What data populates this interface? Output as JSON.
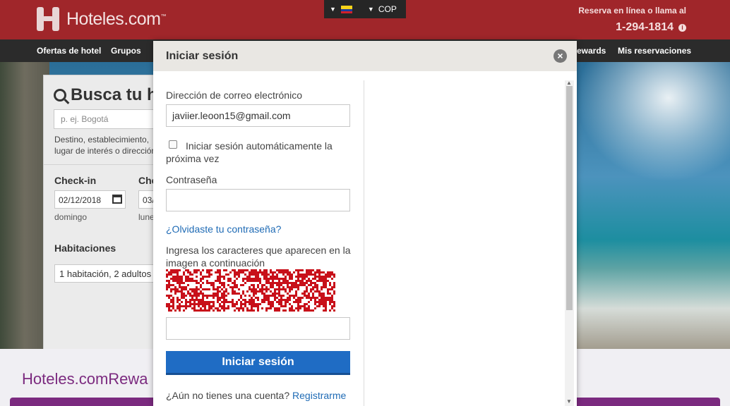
{
  "header": {
    "brand": "Hoteles.com",
    "brand_tm": "™",
    "currency": "COP",
    "phone_label": "Reserva en línea o llama al",
    "phone_number": "1-294-1814",
    "info_glyph": "i"
  },
  "nav": {
    "items": [
      "Ofertas de hotel",
      "Grupos",
      "ewards",
      "Mis reservaciones"
    ]
  },
  "search": {
    "title": "Busca tu h",
    "destination_placeholder": "p. ej. Bogotá",
    "destination_hint": "Destino, establecimiento, lugar de interés o dirección",
    "checkin_label": "Check-in",
    "checkout_label": "Che",
    "checkin_value": "02/12/2018",
    "checkout_value": "03/",
    "checkin_day": "domingo",
    "checkout_day": "lune",
    "rooms_label": "Habitaciones",
    "rooms_value": "1 habitación, 2 adultos"
  },
  "rewards": {
    "logo_text": "Hoteles.comRewa"
  },
  "modal": {
    "title": "Iniciar sesión",
    "close_glyph": "×",
    "email_label": "Dirección de correo electrónico",
    "email_value": "javiier.leoon15@gmail.com",
    "remember_label": "Iniciar sesión automáticamente la próxima vez",
    "password_label": "Contraseña",
    "password_value": "",
    "forgot_link": "¿Olvidaste tu contraseña?",
    "captcha_label": "Ingresa los caracteres que aparecen en la imagen a continuación",
    "captcha_value": "",
    "submit_label": "Iniciar sesión",
    "register_prompt": "¿Aún no tienes una cuenta?",
    "register_link": "Registrarme"
  },
  "colors": {
    "brand_red": "#a0262a",
    "nav_dark": "#2b2b2b",
    "primary_blue": "#1f6cc4",
    "link_blue": "#1f6bb5",
    "rewards_purple": "#7b2a7f",
    "captcha_red": "#c8101a"
  },
  "icons": [
    "hotel-logo-icon",
    "flag-icon",
    "info-icon",
    "search-icon",
    "calendar-icon",
    "close-icon",
    "checkbox-icon"
  ]
}
